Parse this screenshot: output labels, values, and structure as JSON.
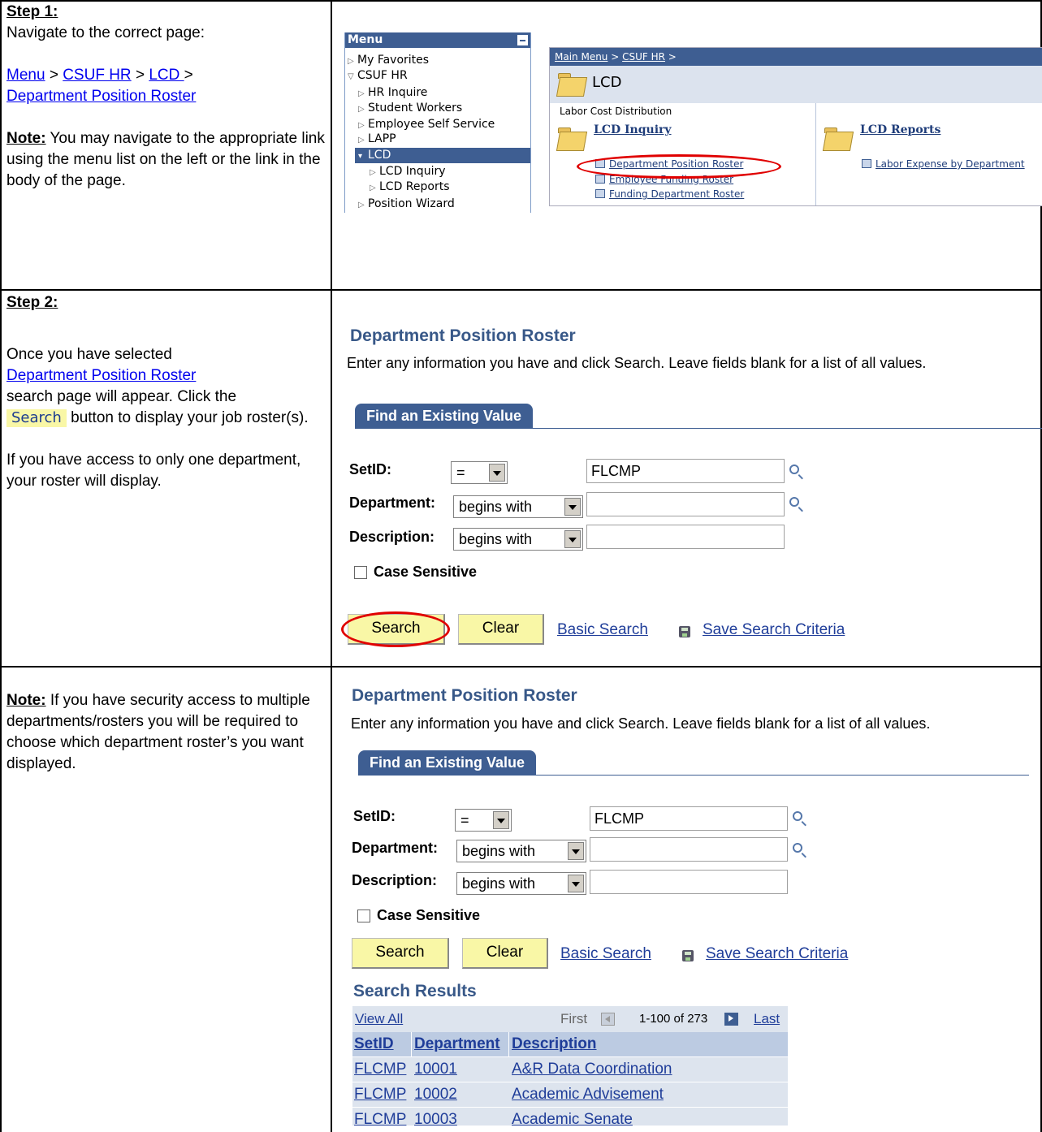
{
  "doc": {
    "step1": {
      "heading": "Step 1:",
      "intro": "Navigate to the correct page:",
      "nav_path": [
        "Menu",
        "CSUF HR",
        "LCD ",
        "Department Position Roster"
      ],
      "sep": ">",
      "note_label": "Note:",
      "note_text": "You may navigate to the appropriate link using the menu list on the left or the link in the body of the page."
    },
    "step2": {
      "heading": "Step 2:",
      "line1": "Once you have selected",
      "link": "Department Position Roster",
      "line2": "search page will appear.  Click the",
      "inline_button": "Search",
      "line3": " button to display your job roster(s).",
      "para2": "If you have access to only one department, your roster will display."
    },
    "step3": {
      "note_label": "Note:",
      "note_text": "  If you have security access to multiple departments/rosters you will be required to choose which department roster’s you want displayed."
    }
  },
  "menu": {
    "title": "Menu",
    "items": [
      {
        "label": "My Favorites",
        "icon": "triangle-right-icon"
      },
      {
        "label": "CSUF HR",
        "icon": "triangle-down-icon"
      },
      {
        "label": "HR Inquire",
        "icon": "triangle-right-icon"
      },
      {
        "label": "Student Workers",
        "icon": "triangle-right-icon"
      },
      {
        "label": "Employee Self Service",
        "icon": "triangle-right-icon"
      },
      {
        "label": "LAPP",
        "icon": "triangle-right-icon"
      },
      {
        "label": "LCD",
        "icon": "triangle-down-icon",
        "selected": true
      },
      {
        "label": "LCD Inquiry",
        "icon": "triangle-right-icon"
      },
      {
        "label": "LCD Reports",
        "icon": "triangle-right-icon"
      },
      {
        "label": "Position Wizard",
        "icon": "triangle-right-icon"
      }
    ]
  },
  "portal": {
    "crumb_main": "Main Menu",
    "crumb_hr": "CSUF HR",
    "crumb_tail": " >",
    "crumb_sep": " > ",
    "title": "LCD",
    "subtitle": "Labor Cost Distribution",
    "inquiry_title": "LCD Inquiry",
    "inquiry_links": [
      "Department Position Roster",
      "Employee Funding Roster",
      "Funding Department Roster"
    ],
    "reports_title": "LCD Reports",
    "reports_links": [
      "Labor Expense by Department"
    ]
  },
  "search_page": {
    "title": "Department Position Roster",
    "instructions": "Enter any information you have and click Search. Leave fields blank for a list of all values.",
    "tab": "Find an Existing Value",
    "setid_label": "SetID:",
    "setid_op": "=",
    "setid_value": "FLCMP",
    "dept_label": "Department:",
    "dept_op": "begins with",
    "dept_value": "",
    "desc_label": "Description:",
    "desc_op": "begins with",
    "desc_value": "",
    "case_label": "Case Sensitive",
    "search_btn": "Search",
    "clear_btn": "Clear",
    "basic_search": "Basic Search",
    "save_criteria": "Save Search Criteria"
  },
  "results": {
    "title": "Search Results",
    "view_all": "View All",
    "first": "First",
    "count": "1-100 of 273",
    "last": "Last",
    "headers": [
      "SetID",
      "Department",
      "Description"
    ],
    "rows": [
      [
        "FLCMP",
        "10001",
        "A&R Data Coordination"
      ],
      [
        "FLCMP",
        "10002",
        "Academic Advisement"
      ],
      [
        "FLCMP",
        "10003",
        "Academic Senate"
      ]
    ]
  }
}
